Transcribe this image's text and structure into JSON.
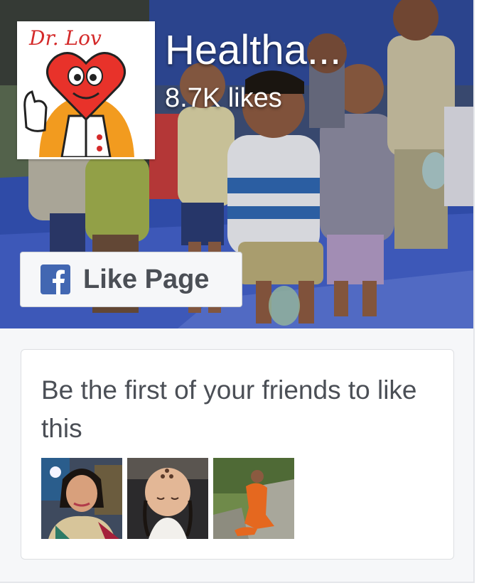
{
  "page": {
    "name": "Healtha...",
    "likes": "8.7K likes",
    "logo_text": "Dr. Love"
  },
  "like_button": {
    "label": "Like Page",
    "icon": "facebook-f-icon"
  },
  "friends": {
    "message": "Be the first of your friends to like this",
    "avatars": [
      {
        "name": "friend-avatar-woman"
      },
      {
        "name": "friend-avatar-baby"
      },
      {
        "name": "friend-avatar-monk"
      }
    ]
  },
  "colors": {
    "facebook_blue": "#4267b2",
    "text_gray": "#4b4f56",
    "panel_bg": "#f6f7f9",
    "cover_tarp_blue": "#3452b6"
  }
}
